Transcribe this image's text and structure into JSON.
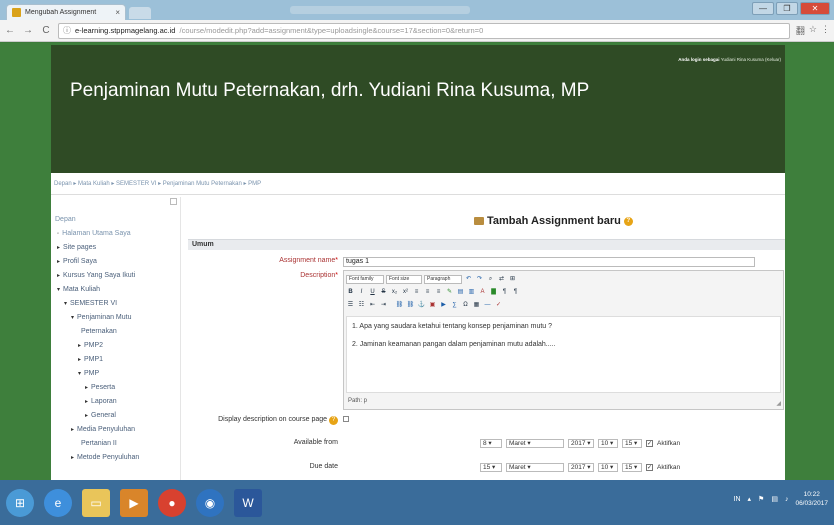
{
  "browser": {
    "tab_title": "Mengubah Assignment",
    "tab_close": "×",
    "address_url": "e-learning.stppmagelang.ac.id",
    "address_path": "/course/modedit.php?add=assignment&type=uploadsingle&course=17&section=0&return=0",
    "back": "←",
    "forward": "→",
    "reload": "C",
    "info_icon": "ⓘ",
    "star_icon": "☆",
    "translate_icon": "翻",
    "menu_icon": "⋮",
    "window_buttons": [
      "—",
      "❐",
      "✕"
    ]
  },
  "header": {
    "site_title": "Penjaminan Mutu Peternakan, drh. Yudiani Rina Kusuma, MP",
    "login_prefix": "Anda login sebagai",
    "login_user": "Yudiani Rina Kusuma (Keluar)"
  },
  "breadcrumb": "Depan ▸ Mata Kuliah ▸ SEMESTER VI ▸ Penjaminan Mutu Peternakan ▸ PMP",
  "sidebar": {
    "title": "Depan",
    "items": [
      {
        "label": "Halaman Utama Saya",
        "tri": "◦",
        "indent": 0
      },
      {
        "label": "Site pages",
        "tri": "▸",
        "indent": 0
      },
      {
        "label": "Profil Saya",
        "tri": "▸",
        "indent": 0
      },
      {
        "label": "Kursus Yang Saya Ikuti",
        "tri": "▸",
        "indent": 0
      },
      {
        "label": "Mata Kuliah",
        "tri": "▾",
        "indent": 0
      },
      {
        "label": "SEMESTER VI",
        "tri": "▾",
        "indent": 1
      },
      {
        "label": "Penjaminan Mutu",
        "tri": "▾",
        "indent": 2
      },
      {
        "label": "Peternakan",
        "tri": "",
        "indent": 3
      },
      {
        "label": "PMP2",
        "tri": "▸",
        "indent": 3
      },
      {
        "label": "PMP1",
        "tri": "▸",
        "indent": 3
      },
      {
        "label": "PMP",
        "tri": "▾",
        "indent": 3
      },
      {
        "label": "Peserta",
        "tri": "▸",
        "indent": 4
      },
      {
        "label": "Laporan",
        "tri": "▸",
        "indent": 4
      },
      {
        "label": "General",
        "tri": "▸",
        "indent": 4
      },
      {
        "label": "Media Penyuluhan",
        "tri": "▸",
        "indent": 2
      },
      {
        "label": "Pertanian II",
        "tri": "",
        "indent": 3
      },
      {
        "label": "Metode Penyuluhan",
        "tri": "▸",
        "indent": 2
      }
    ]
  },
  "form": {
    "title": "Tambah Assignment baru",
    "section": "Umum",
    "name_label": "Assignment name",
    "name_value": "tugas 1",
    "desc_label": "Description",
    "font_family": "Font family",
    "font_size": "Font size",
    "paragraph": "Paragraph",
    "editor_lines": [
      "1. Apa yang saudara ketahui tentang konsep penjaminan mutu ?",
      "2. Jaminan keamanan pangan dalam penjaminan mutu adalah....."
    ],
    "path": "Path: p",
    "display_desc_label": "Display description on course page",
    "available_label": "Available from",
    "available": {
      "day": "8",
      "month": "Maret",
      "year": "2017",
      "hour": "10",
      "minute": "15",
      "enable": "Aktifkan"
    },
    "due_label": "Due date",
    "due": {
      "day": "15",
      "month": "Maret",
      "year": "2017",
      "hour": "10",
      "minute": "15",
      "enable": "Aktifkan"
    }
  },
  "taskbar": {
    "tray_lang": "IN",
    "time": "10:22",
    "date": "06/03/2017"
  }
}
